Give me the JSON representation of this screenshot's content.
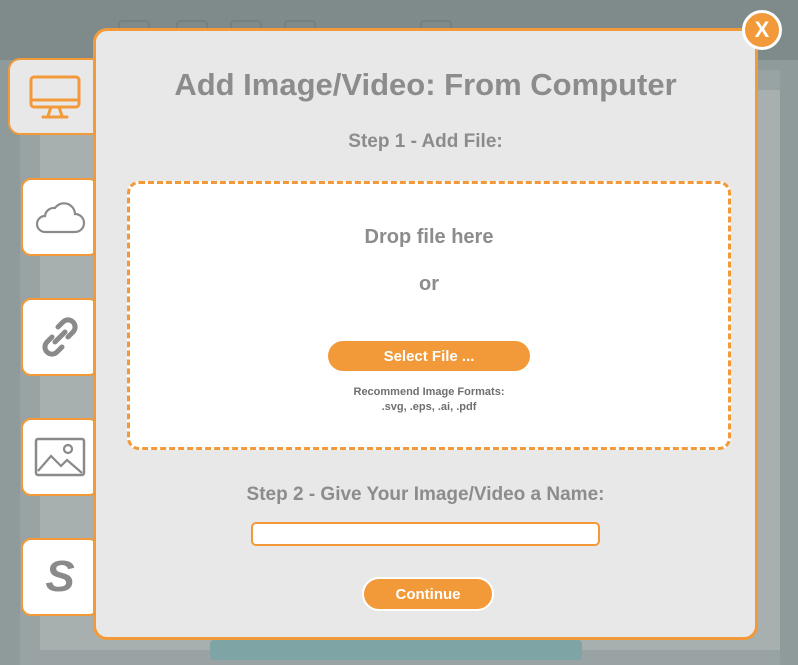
{
  "modal": {
    "title": "Add Image/Video:  From Computer",
    "close_label": "X",
    "step1_label": "Step 1 - Add File:",
    "dropzone": {
      "drop_text": "Drop file here",
      "or_text": "or",
      "select_button": "Select File ...",
      "formats_label": "Recommend Image Formats:",
      "formats_list": ".svg, .eps, .ai, .pdf"
    },
    "step2_label": "Step 2 - Give Your Image/Video a Name:",
    "name_input": {
      "value": "",
      "placeholder": ""
    },
    "continue_button": "Continue"
  },
  "side_tabs": [
    {
      "icon": "computer-icon",
      "active": true
    },
    {
      "icon": "cloud-icon",
      "active": false
    },
    {
      "icon": "link-icon",
      "active": false
    },
    {
      "icon": "image-icon",
      "active": false
    },
    {
      "icon": "s-icon",
      "glyph": "S",
      "active": false
    }
  ],
  "colors": {
    "accent": "#f29a3a",
    "panel": "#e8e8e8",
    "text": "#8c8c8c"
  }
}
